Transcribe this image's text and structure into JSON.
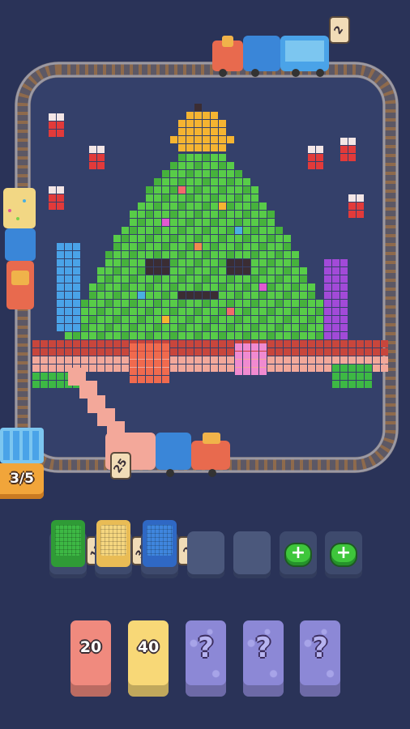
{
  "counter": {
    "progress_text": "3/5"
  },
  "top_train": {
    "tag": "2"
  },
  "bottom_train": {
    "tag": "25"
  },
  "crate_slots": [
    {
      "color": "#2f9b36",
      "tag": "12"
    },
    {
      "color": "#f3d27a",
      "tag": "30"
    },
    {
      "color": "#3a77d6",
      "tag": "2"
    }
  ],
  "color_boxes": [
    {
      "color": "#f08a7e",
      "value": "20"
    },
    {
      "color": "#f8d877",
      "value": "40"
    }
  ],
  "mystery_label": "?",
  "plus_label": "+",
  "colors": {
    "background": "#2a3358",
    "board": "#34406a",
    "rail": "#7e7c86",
    "tree_green": "#52c545",
    "star": "#f5b431"
  }
}
